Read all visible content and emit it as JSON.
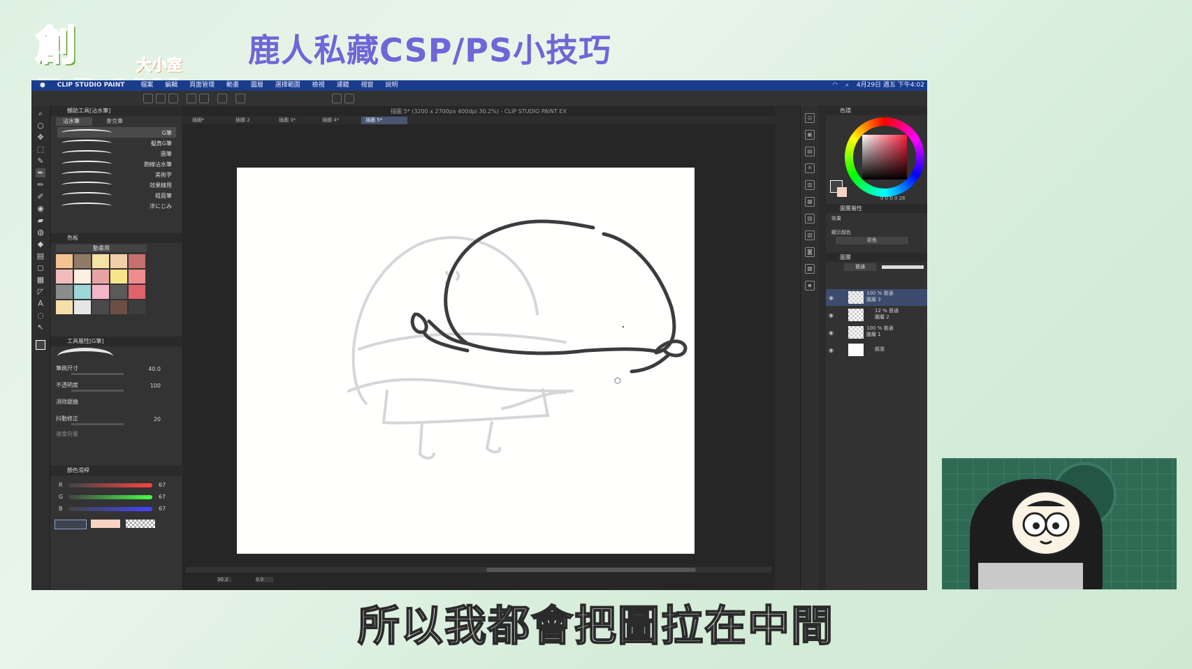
{
  "branding": {
    "logo_text": "創DRAW",
    "logo_sub": "大小室",
    "video_title": "鹿人私藏CSP/PS小技巧"
  },
  "menubar": {
    "apple": "",
    "app_name": "CLIP STUDIO PAINT",
    "items": [
      "檔案",
      "編輯",
      "頁面管理",
      "動畫",
      "圖層",
      "選擇範圍",
      "檢視",
      "濾鏡",
      "視窗",
      "說明"
    ],
    "clock": "4月29日 週五 下午4:02"
  },
  "document": {
    "title": "插圖 5* (3200 x 2700px 400dpi 30.2%) - CLIP STUDIO PAINT EX",
    "tabs": [
      "插圖*",
      "插圖 2",
      "插圖 3*",
      "插圖 4*",
      "插圖 5*"
    ],
    "zoom": "30.2",
    "rotation": "0.0"
  },
  "sub_tool": {
    "header": "輔助工具[沾水筆]",
    "group_tabs": [
      "沾水筆",
      "麥克筆"
    ],
    "brushes": [
      "G筆",
      "擬真G筆",
      "圓筆",
      "飽線沾水筆",
      "美術字",
      "效果線用",
      "粗面筆",
      "滲にじみ"
    ]
  },
  "color_set": {
    "header": "色板",
    "set_name": "動畫用",
    "swatches": [
      "#f3c391",
      "#8f7b68",
      "#f6e2a5",
      "#f0cfa9",
      "#c76e6e",
      "#f2bcbc",
      "#fbeee3",
      "#e8a3a3",
      "#f7e58a",
      "#ee8d8d",
      "#8c8c8c",
      "#9fd6d9",
      "#f5b4c8",
      "#5a5a5a",
      "#e0626a",
      "#f5dea8",
      "#e6e6e6",
      "#4a4a4a",
      "#6b4f45",
      "#3d3d3d"
    ]
  },
  "tool_property": {
    "header": "工具屬性[G筆]",
    "brush_size_label": "筆刷尺寸",
    "brush_size": "40.0",
    "opacity_label": "不透明度",
    "opacity": "100",
    "aa_label": "消除鋸齒",
    "stabilization_label": "抖動修正",
    "stabilization": "20",
    "speed_label": "速度向量"
  },
  "color_slider": {
    "header": "顏色滑桿",
    "r": "67",
    "g": "67",
    "b": "67"
  },
  "color_wheel": {
    "header": "色環",
    "readout": "0  0  0  0  26"
  },
  "layer_property": {
    "header": "圖層屬性",
    "effect_label": "效果",
    "display_color_label": "顯示顏色",
    "display_color_value": "彩色"
  },
  "layers": {
    "header": "圖層",
    "blend_mode": "普通",
    "items": [
      {
        "mode": "100 % 普通",
        "name": "圖層 3"
      },
      {
        "mode": "12 % 普通",
        "name": "圖層 2"
      },
      {
        "mode": "100 % 普通",
        "name": "圖層 1"
      },
      {
        "mode": "",
        "name": "紙張"
      }
    ]
  },
  "subtitle": "所以我都會把圖拉在中間"
}
